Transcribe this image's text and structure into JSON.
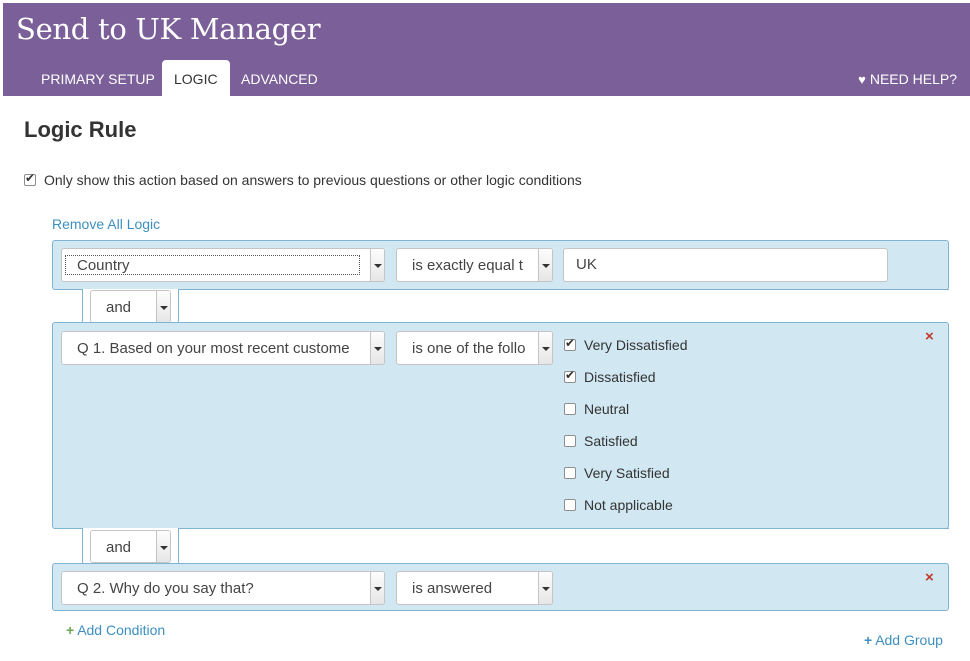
{
  "header": {
    "title": "Send to UK Manager",
    "tabs": [
      {
        "label": "PRIMARY SETUP",
        "active": false
      },
      {
        "label": "LOGIC",
        "active": true
      },
      {
        "label": "ADVANCED",
        "active": false
      }
    ],
    "help_label": "NEED HELP?",
    "background": "#7b5f99"
  },
  "page": {
    "title": "Logic Rule",
    "toggle_label": "Only show this action based on answers to previous questions or other logic conditions",
    "toggle_checked": true,
    "remove_all_label": "Remove All Logic"
  },
  "conditions": [
    {
      "question": "Country",
      "operator": "is exactly equal t",
      "value": "UK"
    },
    {
      "connector": "and",
      "question": "Q 1. Based on your most recent custome",
      "operator": "is one of the follo",
      "options": [
        {
          "label": "Very Dissatisfied",
          "checked": true
        },
        {
          "label": "Dissatisfied",
          "checked": true
        },
        {
          "label": "Neutral",
          "checked": false
        },
        {
          "label": "Satisfied",
          "checked": false
        },
        {
          "label": "Very Satisfied",
          "checked": false
        },
        {
          "label": "Not applicable",
          "checked": false
        }
      ],
      "remove_icon": "×"
    },
    {
      "connector": "and",
      "question": "Q 2. Why do you say that?",
      "operator": "is answered",
      "remove_icon": "×"
    }
  ],
  "actions": {
    "add_condition": "Add Condition",
    "add_group": "Add Group"
  },
  "colors": {
    "accent_link": "#3d8fc1",
    "condition_bg": "#d1e7f2",
    "remove_x": "#c0392b",
    "add_plus": "#6aa84f"
  }
}
